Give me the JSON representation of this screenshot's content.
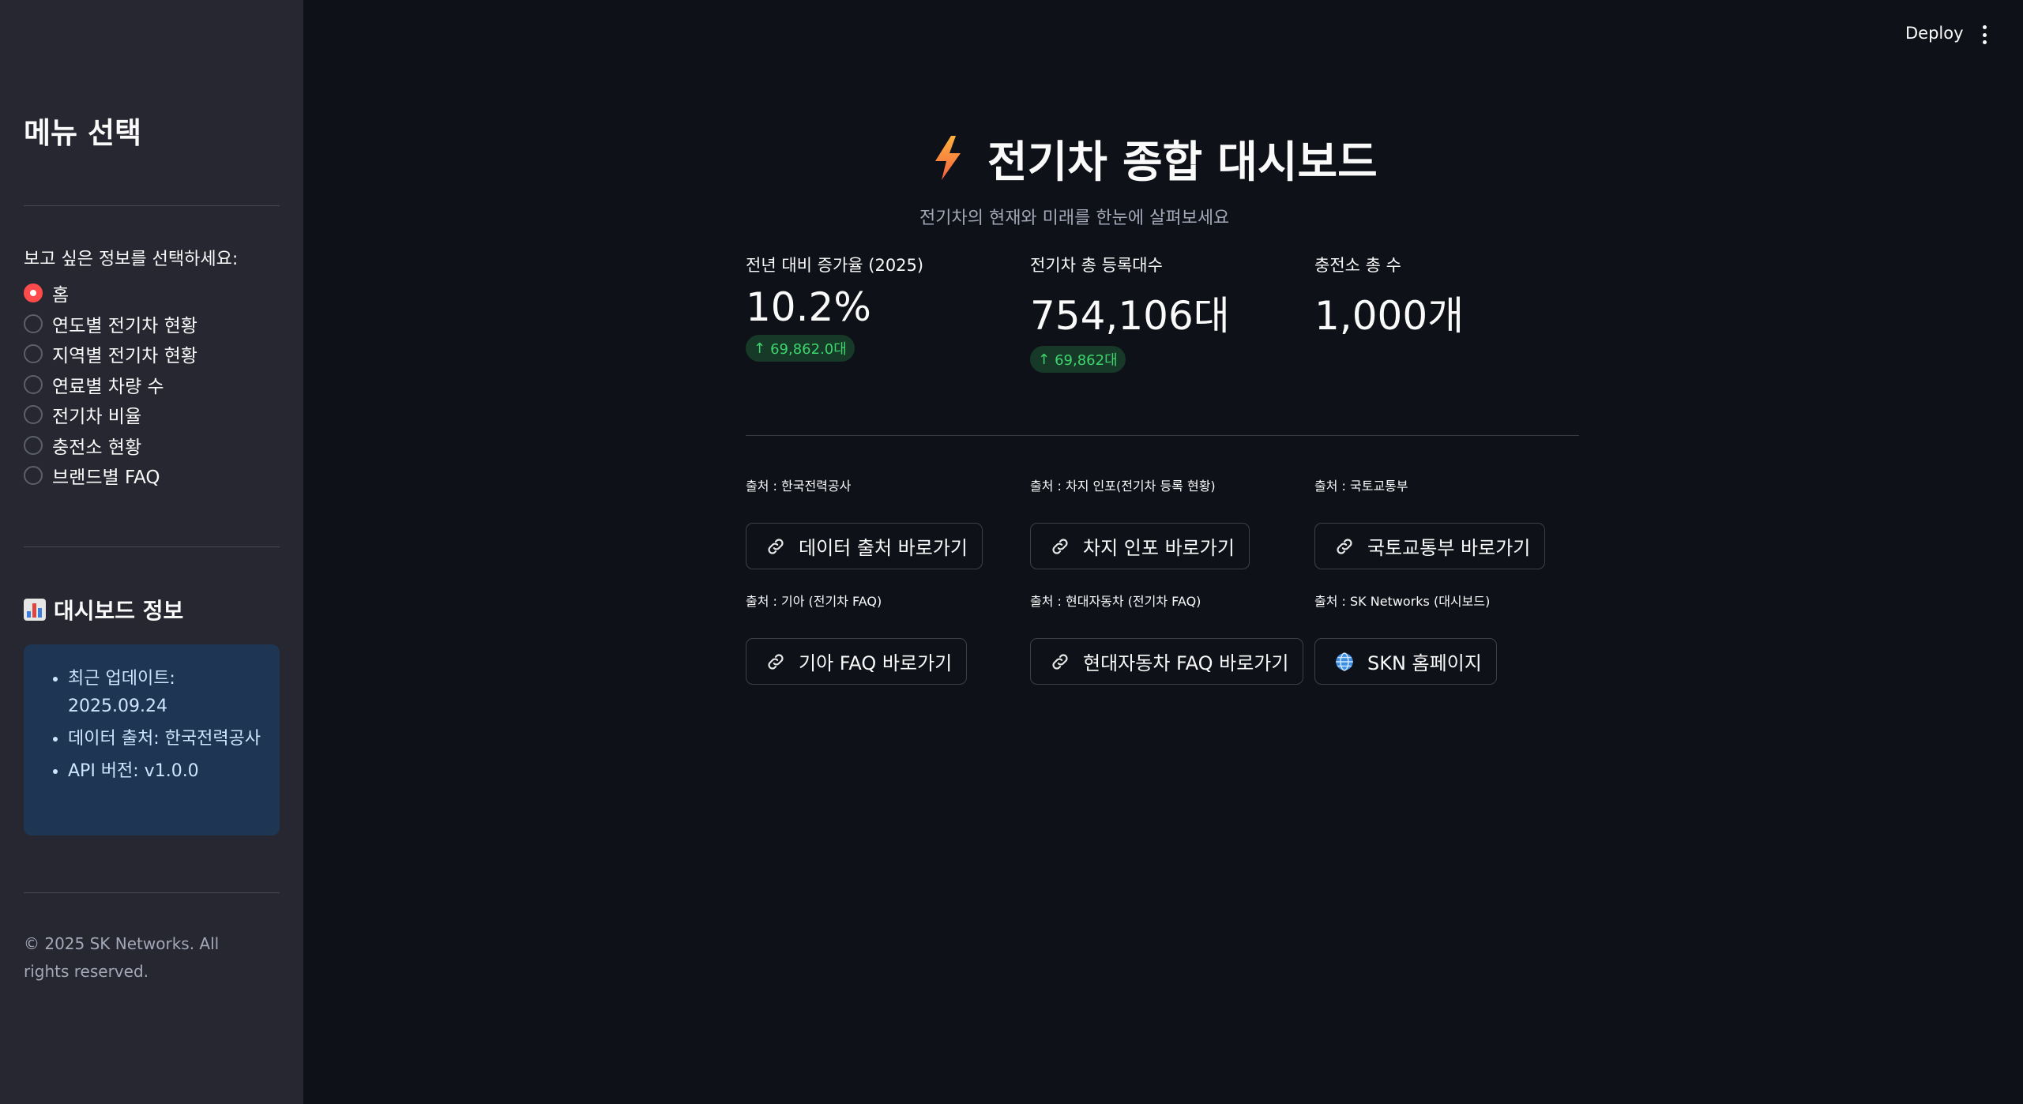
{
  "sidebar": {
    "title": "메뉴 선택",
    "radio_prompt": "보고 싶은 정보를 선택하세요:",
    "options": [
      {
        "label": "홈",
        "selected": true
      },
      {
        "label": "연도별 전기차 현황",
        "selected": false
      },
      {
        "label": "지역별 전기차 현황",
        "selected": false
      },
      {
        "label": "연료별 차량 수",
        "selected": false
      },
      {
        "label": "전기차 비율",
        "selected": false
      },
      {
        "label": "충전소 현황",
        "selected": false
      },
      {
        "label": "브랜드별 FAQ",
        "selected": false
      }
    ],
    "info_title": "대시보드 정보",
    "info_icon": "bar-chart-icon",
    "info_items": [
      "최근 업데이트: 2025.09.24",
      "데이터 출처: 한국전력공사",
      "API 버전: v1.0.0"
    ],
    "copyright": "© 2025 SK Networks. All rights reserved."
  },
  "header": {
    "deploy_label": "Deploy",
    "menu_icon": "kebab-menu-icon"
  },
  "main": {
    "title_icon": "lightning-bolt-icon",
    "title": "전기차 종합 대시보드",
    "subtitle": "전기차의 현재와 미래를 한눈에 살펴보세요",
    "metrics": [
      {
        "label": "전년 대비 증가율 (2025)",
        "value": "10.2%",
        "delta": "69,862.0대"
      },
      {
        "label": "전기차 총 등록대수",
        "value": "754,106대",
        "delta": "69,862대"
      },
      {
        "label": "충전소 총 수",
        "value": "1,000개",
        "delta": ""
      }
    ],
    "sources": [
      {
        "label": "출처 : 한국전력공사",
        "button": "데이터 출처 바로가기",
        "icon": "link-icon"
      },
      {
        "label": "출처 : 차지 인포(전기차 등록 현황)",
        "button": "차지 인포 바로가기",
        "icon": "link-icon"
      },
      {
        "label": "출처 : 국토교통부",
        "button": "국토교통부 바로가기",
        "icon": "link-icon"
      },
      {
        "label": "출처 : 기아 (전기차 FAQ)",
        "button": "기아 FAQ 바로가기",
        "icon": "link-icon"
      },
      {
        "label": "출처 : 현대자동차 (전기차 FAQ)",
        "button": "현대자동차 FAQ 바로가기",
        "icon": "link-icon"
      },
      {
        "label": "출처 : SK Networks (대시보드)",
        "button": "SKN 홈페이지",
        "icon": "globe-icon"
      }
    ]
  },
  "colors": {
    "accent": "#ff4b4b",
    "delta_bg": "#173928",
    "delta_text": "#3dd56d",
    "info_bg": "#1e3653"
  }
}
